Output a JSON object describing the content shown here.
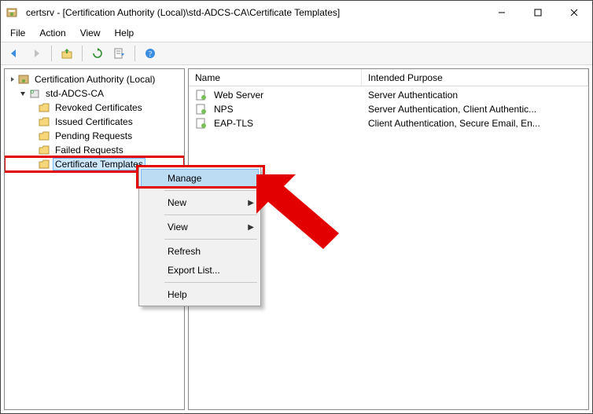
{
  "window": {
    "title": "certsrv - [Certification Authority (Local)\\std-ADCS-CA\\Certificate Templates]"
  },
  "menubar": [
    "File",
    "Action",
    "View",
    "Help"
  ],
  "tree": {
    "root": {
      "label": "Certification Authority (Local)"
    },
    "ca": {
      "label": "std-ADCS-CA"
    },
    "nodes": [
      {
        "label": "Revoked Certificates"
      },
      {
        "label": "Issued Certificates"
      },
      {
        "label": "Pending Requests"
      },
      {
        "label": "Failed Requests"
      },
      {
        "label": "Certificate Templates"
      }
    ]
  },
  "list": {
    "columns": [
      "Name",
      "Intended Purpose"
    ],
    "rows": [
      {
        "name": "Web Server",
        "purpose": "Server Authentication"
      },
      {
        "name": "NPS",
        "purpose": "Server Authentication, Client Authentic..."
      },
      {
        "name": "EAP-TLS",
        "purpose": "Client Authentication, Secure Email, En..."
      }
    ]
  },
  "context_menu": {
    "items": [
      {
        "label": "Manage",
        "highlighted": true
      },
      {
        "sep": true
      },
      {
        "label": "New",
        "submenu": true
      },
      {
        "sep": true
      },
      {
        "label": "View",
        "submenu": true
      },
      {
        "sep": true
      },
      {
        "label": "Refresh"
      },
      {
        "label": "Export List..."
      },
      {
        "sep": true
      },
      {
        "label": "Help"
      }
    ]
  }
}
